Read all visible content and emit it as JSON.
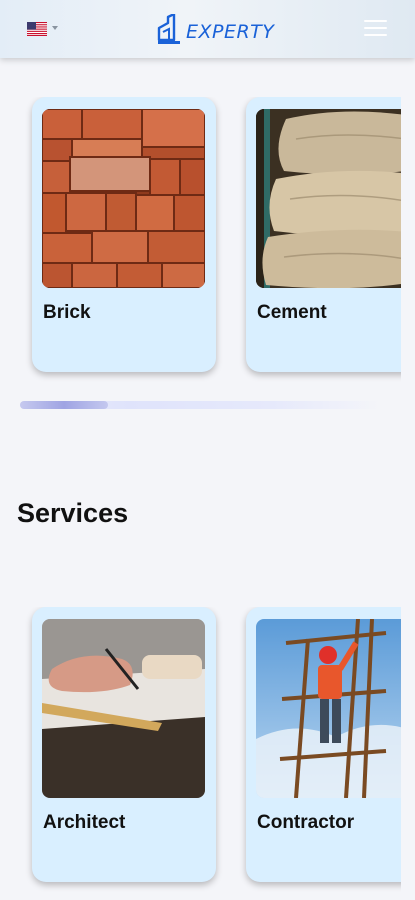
{
  "header": {
    "language_icon": "us-flag-icon",
    "logo_text": "EXPERTY",
    "menu_icon": "hamburger-icon",
    "brand_color": "#1a62d8"
  },
  "materials": {
    "items": [
      {
        "label": "Brick",
        "image": "stacked-bricks"
      },
      {
        "label": "Cement",
        "image": "cement-sacks"
      }
    ],
    "scroll_position": 0.0
  },
  "services": {
    "title": "Services",
    "items": [
      {
        "label": "Architect",
        "image": "architect-drafting"
      },
      {
        "label": "Contractor",
        "image": "contractor-on-scaffold"
      }
    ]
  },
  "colors": {
    "card_background": "#d9efff",
    "page_background": "#f4f5f9"
  }
}
